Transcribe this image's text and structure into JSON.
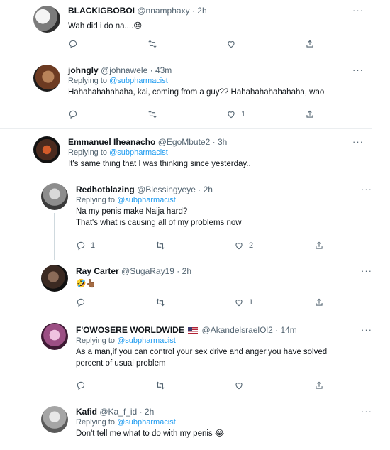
{
  "tweets": [
    {
      "name": "BLACKIGBOBOI",
      "handle": "@nnamphaxy",
      "time": "2h",
      "reply_prefix": "",
      "reply_to": "",
      "lines": [
        "Wah did i do na....😞"
      ],
      "replies": "",
      "retweets": "",
      "likes": ""
    },
    {
      "name": "johngly",
      "handle": "@johnawele",
      "time": "43m",
      "reply_prefix": "Replying to",
      "reply_to": "@subpharmacist",
      "lines": [
        "Hahahahahahaha, kai, coming from a guy?? Hahahahahahahaha, wao"
      ],
      "replies": "",
      "retweets": "",
      "likes": "1"
    },
    {
      "name": "Emmanuel Iheanacho",
      "handle": "@EgoMbute2",
      "time": "3h",
      "reply_prefix": "Replying to",
      "reply_to": "@subpharmacist",
      "lines": [
        "It's same thing that I was thinking since yesterday.."
      ],
      "replies": "",
      "retweets": "",
      "likes": ""
    },
    {
      "name": "Redhotblazing",
      "handle": "@Blessingyeye",
      "time": "2h",
      "reply_prefix": "Replying to",
      "reply_to": "@subpharmacist",
      "lines": [
        "Na my penis make Naija hard?",
        "That's what is causing all of my problems now"
      ],
      "replies": "1",
      "retweets": "",
      "likes": "2"
    },
    {
      "name": "Ray Carter",
      "handle": "@SugaRay19",
      "time": "2h",
      "reply_prefix": "",
      "reply_to": "",
      "lines": [
        "🤣👆🏾"
      ],
      "replies": "",
      "retweets": "",
      "likes": "1"
    },
    {
      "name": "F'OWOSERE WORLDWIDE",
      "handle": "@AkandelsraelOl2",
      "time": "14m",
      "reply_prefix": "Replying to",
      "reply_to": "@subpharmacist",
      "lines": [
        "As a man,if you can control your sex drive and anger,you have solved",
        "percent of usual problem"
      ],
      "replies": "",
      "retweets": "",
      "likes": ""
    },
    {
      "name": "Kafid",
      "handle": "@Ka_f_id",
      "time": "2h",
      "reply_prefix": "Replying to",
      "reply_to": "@subpharmacist",
      "lines": [
        "Don't tell me what to do with my penis 😂"
      ],
      "replies": "",
      "retweets": "",
      "likes": ""
    }
  ],
  "ui": {
    "more": "···",
    "separator": "·",
    "accent": "#1d9bf0",
    "muted": "#536471",
    "icons": [
      "reply-icon",
      "retweet-icon",
      "like-icon",
      "share-icon",
      "more-icon"
    ]
  }
}
